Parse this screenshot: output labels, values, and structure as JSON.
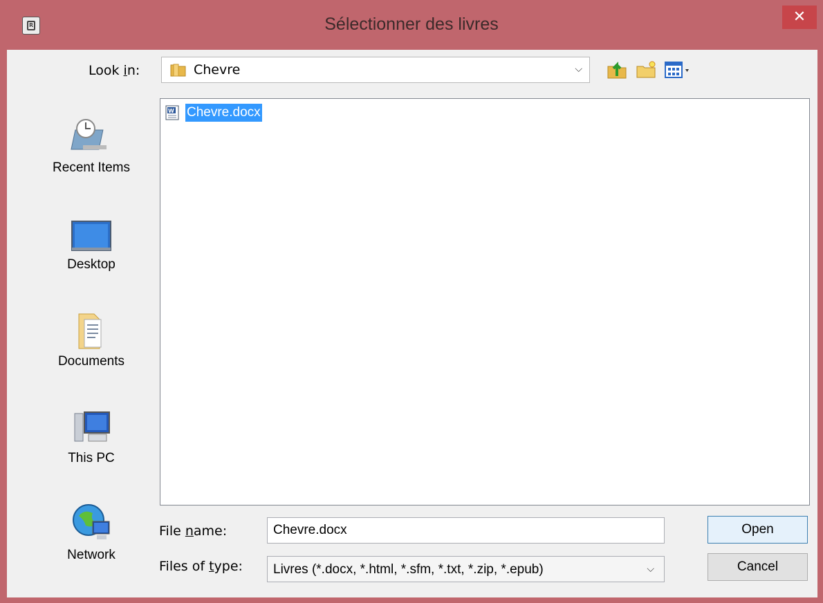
{
  "window": {
    "title": "Sélectionner des livres",
    "close_glyph": "✕",
    "app_icon_letter": "R"
  },
  "lookin": {
    "label_before": "Look ",
    "label_accel": "i",
    "label_after": "n:",
    "value": "Chevre"
  },
  "toolbar": {
    "icons": [
      "up-folder-icon",
      "new-folder-icon",
      "view-menu-icon"
    ]
  },
  "places": [
    {
      "label": "Recent Items",
      "icon": "recent-items-icon"
    },
    {
      "label": "Desktop",
      "icon": "desktop-icon"
    },
    {
      "label": "Documents",
      "icon": "documents-icon"
    },
    {
      "label": "This PC",
      "icon": "computer-icon"
    },
    {
      "label": "Network",
      "icon": "network-icon"
    }
  ],
  "files": [
    {
      "name": "Chevre.docx",
      "icon": "word-document-icon",
      "selected": true
    }
  ],
  "filename": {
    "label_before": "File ",
    "label_accel": "n",
    "label_after": "ame:",
    "value": "Chevre.docx"
  },
  "filetype": {
    "label_before": "Files of ",
    "label_accel": "t",
    "label_after": "ype:",
    "value": "Livres (*.docx, *.html, *.sfm, *.txt, *.zip, *.epub)"
  },
  "buttons": {
    "open": "Open",
    "cancel": "Cancel"
  },
  "colors": {
    "titlebar": "#c0666d",
    "close": "#c7454a",
    "selection": "#3399ff",
    "dialog_bg": "#f0f0f0"
  }
}
